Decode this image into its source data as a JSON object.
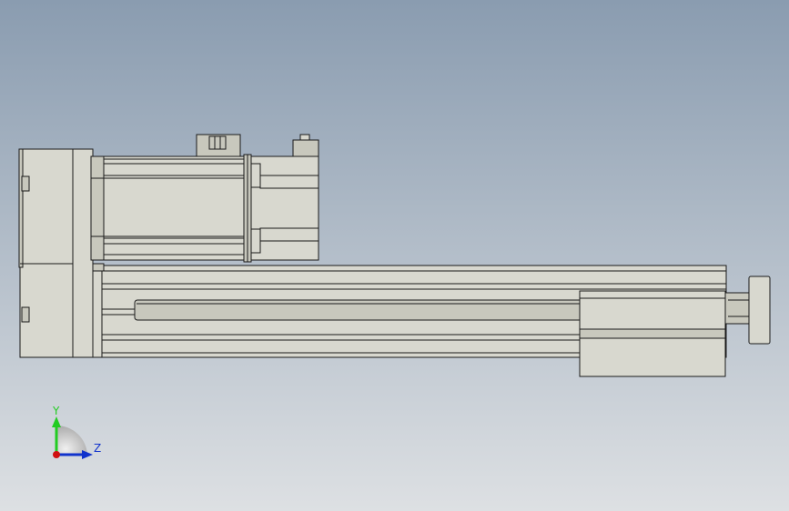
{
  "viewport": {
    "background_top": "#8a9cb0",
    "background_bottom": "#dde0e3"
  },
  "model": {
    "body_fill": "#d8d8cf",
    "shade_fill": "#c8c8bd",
    "edge_color": "#1a1a1a"
  },
  "triad": {
    "y_label": "Y",
    "z_label": "Z",
    "y_color": "#22cc22",
    "z_color": "#1133cc",
    "x_color": "#d01010"
  }
}
